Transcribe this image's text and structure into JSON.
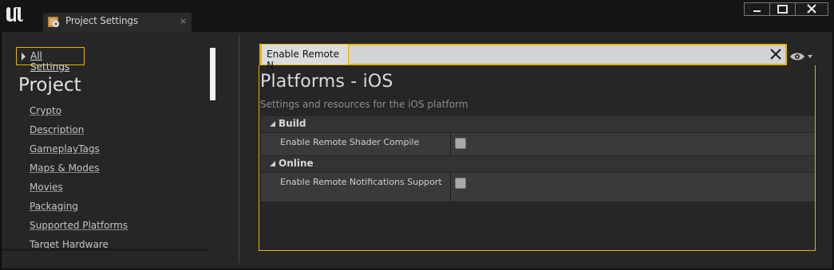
{
  "tab": {
    "label": "Project Settings",
    "close_glyph": "×"
  },
  "window_controls": [
    "minimize-icon",
    "maximize-icon",
    "close-icon"
  ],
  "sidebar": {
    "all_settings_label": "All Settings",
    "section_title": "Project",
    "items": [
      {
        "label": "Crypto"
      },
      {
        "label": "Description"
      },
      {
        "label": "GameplayTags"
      },
      {
        "label": "Maps & Modes"
      },
      {
        "label": "Movies"
      },
      {
        "label": "Packaging"
      },
      {
        "label": "Supported Platforms"
      },
      {
        "label": "Target Hardware"
      }
    ]
  },
  "search": {
    "value": "Enable Remote N"
  },
  "details": {
    "title": "Platforms - iOS",
    "subtitle": "Settings and resources for the iOS platform",
    "categories": [
      {
        "label": "Build",
        "properties": [
          {
            "label": "Enable Remote Shader Compile",
            "checked": false
          }
        ]
      },
      {
        "label": "Online",
        "properties": [
          {
            "label": "Enable Remote Notifications Support",
            "checked": false
          }
        ]
      }
    ]
  },
  "colors": {
    "accent": "#e6b400",
    "background": "#262626",
    "titlebar": "#151515"
  }
}
